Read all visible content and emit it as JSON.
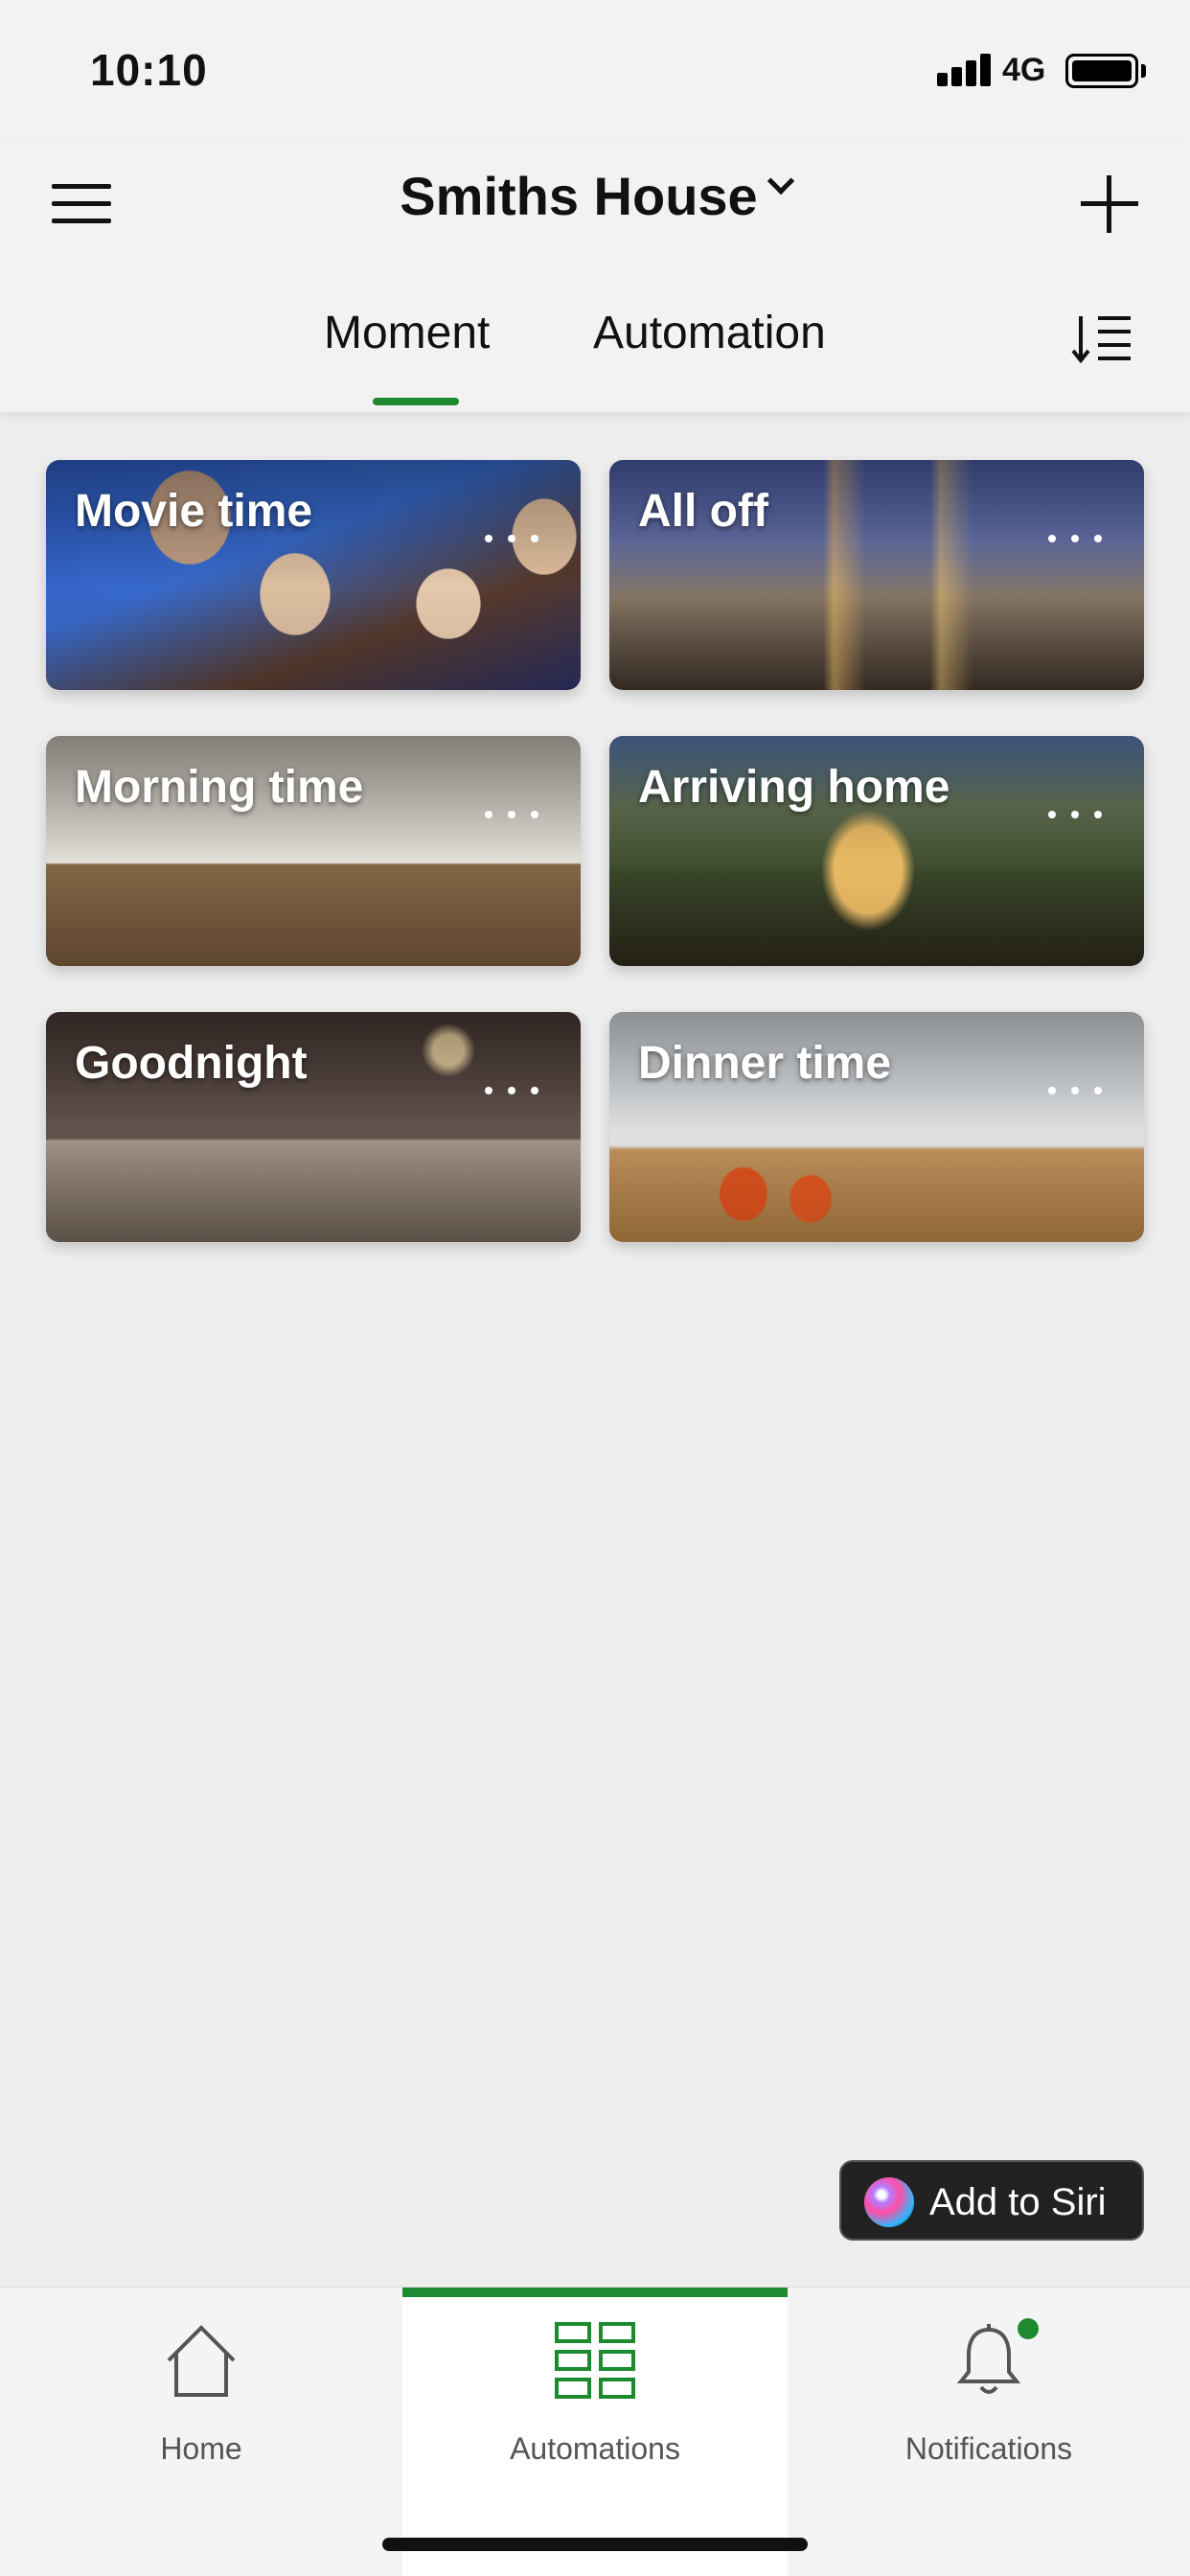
{
  "status_bar": {
    "time": "10:10",
    "network": "4G"
  },
  "header": {
    "house_name": "Smiths House",
    "menu_icon": "hamburger-menu-icon",
    "add_icon": "plus-icon",
    "sort_icon": "sort-list-icon"
  },
  "tabs": [
    {
      "label": "Moment",
      "active": true
    },
    {
      "label": "Automation",
      "active": false
    }
  ],
  "moments": [
    {
      "title": "Movie time",
      "more_icon": "more-dots-icon",
      "scene": "family-watching-tv"
    },
    {
      "title": "All off",
      "more_icon": "more-dots-icon",
      "scene": "house-at-dusk"
    },
    {
      "title": "Morning time",
      "more_icon": "more-dots-icon",
      "scene": "bright-bedroom"
    },
    {
      "title": "Arriving home",
      "more_icon": "more-dots-icon",
      "scene": "lit-house-entrance"
    },
    {
      "title": "Goodnight",
      "more_icon": "more-dots-icon",
      "scene": "dim-bedroom"
    },
    {
      "title": "Dinner time",
      "more_icon": "more-dots-icon",
      "scene": "dining-kitchen"
    }
  ],
  "siri_button": {
    "label": "Add to Siri",
    "icon": "siri-icon"
  },
  "bottom_nav": [
    {
      "label": "Home",
      "icon": "home-icon",
      "active": false
    },
    {
      "label": "Automations",
      "icon": "automations-grid-icon",
      "active": true
    },
    {
      "label": "Notifications",
      "icon": "bell-icon",
      "active": false,
      "badge": true
    }
  ],
  "colors": {
    "accent": "#1e8a2f",
    "background": "#eeeeee",
    "header": "#f2f2f2"
  }
}
